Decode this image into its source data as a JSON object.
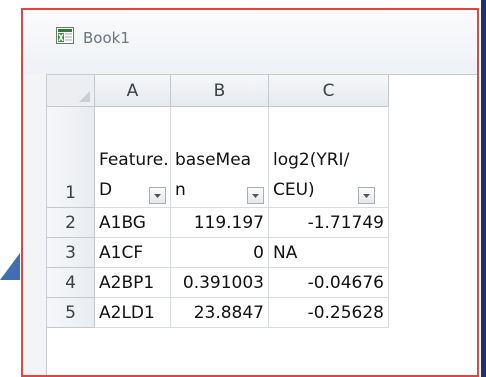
{
  "workbook": {
    "title": "Book1",
    "icon": "excel-workbook-icon"
  },
  "columns": [
    "A",
    "B",
    "C"
  ],
  "header_row": {
    "row_label": "1",
    "cells": [
      {
        "line1": "Feature.I",
        "line2": "D"
      },
      {
        "line1": "baseMea",
        "line2": "n"
      },
      {
        "line1": "log2(YRI/",
        "line2": "CEU)"
      }
    ]
  },
  "rows": [
    {
      "row_label": "2",
      "cells": [
        "A1BG",
        "119.197",
        "-1.71749"
      ]
    },
    {
      "row_label": "3",
      "cells": [
        "A1CF",
        "0",
        "NA"
      ]
    },
    {
      "row_label": "4",
      "cells": [
        "A2BP1",
        "0.391003",
        "-0.04676"
      ]
    },
    {
      "row_label": "5",
      "cells": [
        "A2LD1",
        "23.8847",
        "-0.25628"
      ]
    }
  ],
  "colors": {
    "window_border": "#e04545",
    "header_bg": "#eceef1",
    "side_arrow": "#3f6fb0"
  }
}
